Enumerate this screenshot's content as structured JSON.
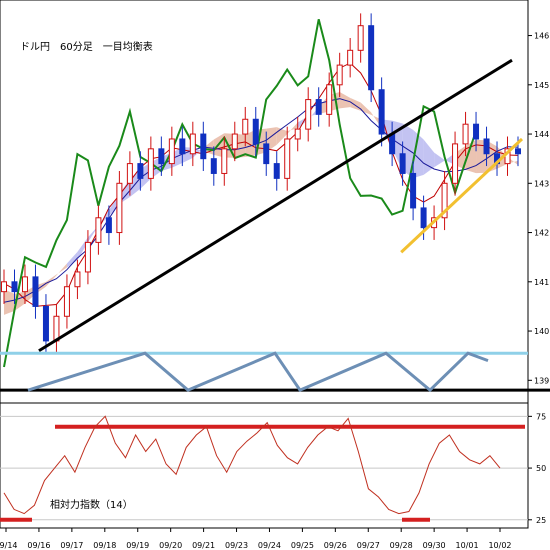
{
  "chart_data": [
    {
      "type": "candlestick",
      "title": "ドル円　60分足　一目均衡表",
      "y_axis_ticks": [
        139,
        140,
        141,
        142,
        143,
        144,
        145,
        146
      ],
      "ylim": [
        138.6,
        146.6
      ],
      "x_tick_labels": [
        "09/14",
        "09/16",
        "09/17",
        "09/18",
        "09/19",
        "09/20",
        "09/21",
        "09/23",
        "09/24",
        "09/25",
        "09/26",
        "09/27",
        "09/28",
        "09/30",
        "10/01",
        "10/02"
      ],
      "series": [
        {
          "name": "",
          "values": [
            141.0,
            140.8,
            141.1,
            140.5,
            139.8,
            140.3,
            140.9,
            141.2,
            141.8,
            142.3,
            142.0,
            143.0,
            143.4,
            143.1,
            143.7,
            143.4,
            143.9,
            143.6,
            144.0,
            143.5,
            143.2,
            143.7,
            144.0,
            144.3,
            143.8,
            143.4,
            143.1,
            143.9,
            144.1,
            144.7,
            144.4,
            145.0,
            145.4,
            145.7,
            146.2,
            144.9,
            144.0,
            143.6,
            143.2,
            142.5,
            142.1,
            142.3,
            143.0,
            143.8,
            144.2,
            143.9,
            143.6,
            143.4,
            143.7,
            143.6
          ]
        }
      ],
      "annotations": {
        "upper_trend_line": {
          "from": [
            "09/16",
            139.6
          ],
          "to": [
            "10/02",
            145.5
          ]
        },
        "lower_trend_line": {
          "from": [
            "09/28",
            141.6
          ],
          "to": [
            "10/02",
            143.9
          ]
        }
      }
    },
    {
      "type": "line",
      "title": "相対力指数（14）",
      "y_axis_ticks": [
        25,
        50,
        75
      ],
      "ylim": [
        22,
        80
      ],
      "series": [
        {
          "name": "",
          "values": [
            38,
            30,
            28,
            32,
            44,
            50,
            56,
            48,
            60,
            70,
            75,
            62,
            55,
            66,
            58,
            64,
            52,
            47,
            60,
            66,
            70,
            56,
            48,
            58,
            63,
            67,
            72,
            61,
            55,
            52,
            60,
            66,
            70,
            68,
            74,
            58,
            40,
            36,
            30,
            28,
            29,
            38,
            52,
            62,
            66,
            58,
            54,
            52,
            56,
            50
          ]
        }
      ],
      "reference_lines": {
        "upper": 70,
        "lower": 25
      }
    }
  ]
}
